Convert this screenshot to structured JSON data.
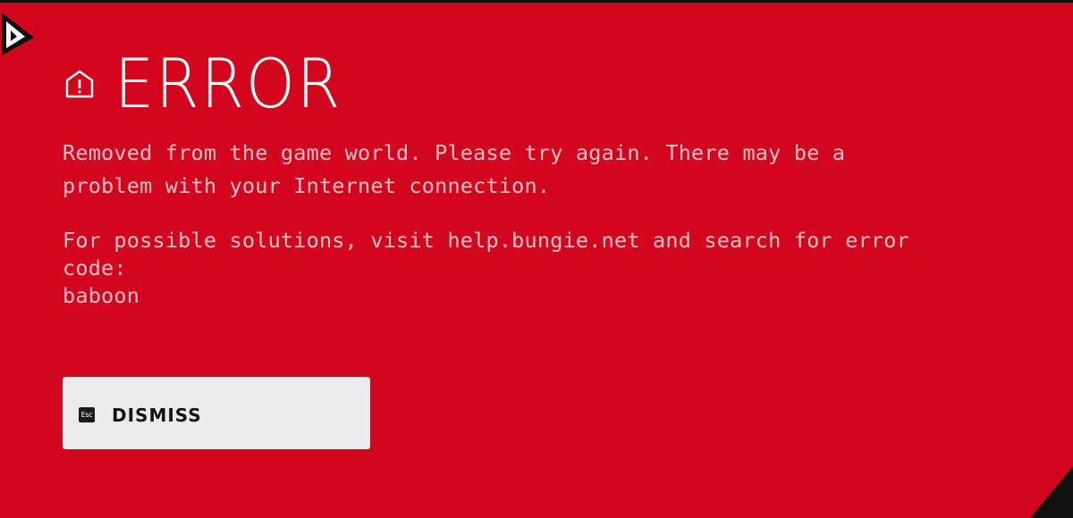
{
  "dialog": {
    "title": "ERROR",
    "message_line1": "Removed from the game world. Please try again. There may be a",
    "message_line2": "problem with your Internet connection.",
    "solutions_line1": "For possible solutions, visit help.bungie.net and search for error",
    "solutions_line2": "code:",
    "error_code": "baboon",
    "icon": "warning-icon"
  },
  "dismiss": {
    "key_label": "Esc",
    "label": "DISMISS"
  },
  "colors": {
    "background": "#d3061d",
    "title": "#ffffff",
    "body_text": "#f6c3c8",
    "button_bg": "#ebebee",
    "button_text": "#141414"
  }
}
